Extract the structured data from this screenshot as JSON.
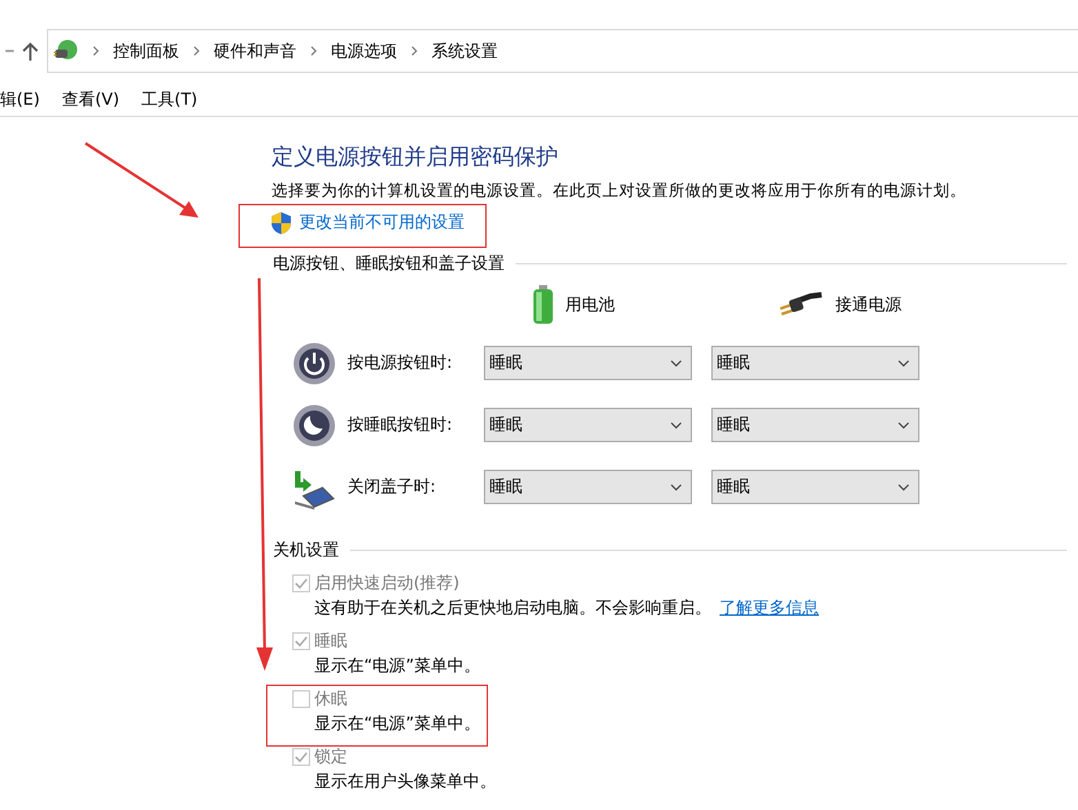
{
  "address_bar": {
    "breadcrumb": [
      "控制面板",
      "硬件和声音",
      "电源选项",
      "系统设置"
    ]
  },
  "menu_bar": {
    "items": [
      "辑(E)",
      "查看(V)",
      "工具(T)"
    ]
  },
  "page": {
    "title": "定义电源按钮并启用密码保护",
    "description": "选择要为你的计算机设置的电源设置。在此页上对设置所做的更改将应用于你所有的电源计划。",
    "admin_link": "更改当前不可用的设置"
  },
  "power_buttons": {
    "heading": "电源按钮、睡眠按钮和盖子设置",
    "columns": [
      {
        "kind": "battery",
        "label": "用电池"
      },
      {
        "kind": "plugged",
        "label": "接通电源"
      }
    ],
    "rows": [
      {
        "kind": "power",
        "label": "按电源按钮时:",
        "values": [
          "睡眠",
          "睡眠"
        ]
      },
      {
        "kind": "sleep",
        "label": "按睡眠按钮时:",
        "values": [
          "睡眠",
          "睡眠"
        ]
      },
      {
        "kind": "lid",
        "label": "关闭盖子时:",
        "values": [
          "睡眠",
          "睡眠"
        ]
      }
    ]
  },
  "shutdown": {
    "heading": "关机设置",
    "items": [
      {
        "label": "启用快速启动(推荐)",
        "description": "这有助于在关机之后更快地启动电脑。不会影响重启。",
        "link": "了解更多信息",
        "checked": true,
        "disabled": true
      },
      {
        "label": "睡眠",
        "description": "显示在“电源”菜单中。",
        "checked": true,
        "disabled": true
      },
      {
        "label": "休眠",
        "description": "显示在“电源”菜单中。",
        "checked": false,
        "disabled": true
      },
      {
        "label": "锁定",
        "description": "显示在用户头像菜单中。",
        "checked": true,
        "disabled": true
      }
    ]
  }
}
